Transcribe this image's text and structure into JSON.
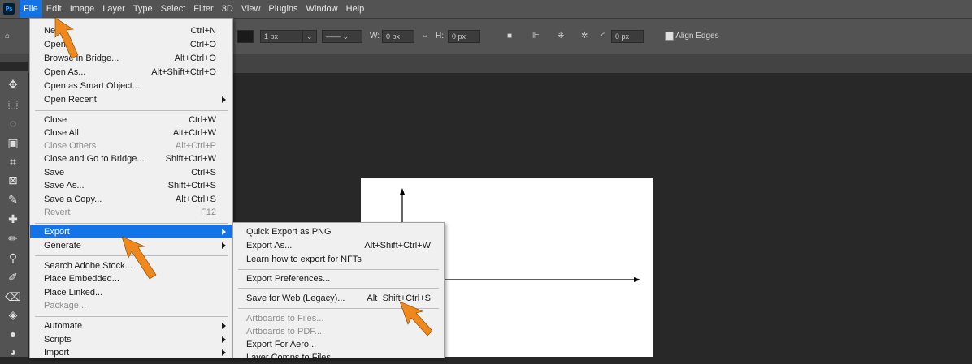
{
  "app": {
    "logo": "Ps"
  },
  "menubar": {
    "items": [
      "File",
      "Edit",
      "Image",
      "Layer",
      "Type",
      "Select",
      "Filter",
      "3D",
      "View",
      "Plugins",
      "Window",
      "Help"
    ],
    "active": "File"
  },
  "options": {
    "stroke_width": "1 px",
    "w_label": "W:",
    "w_value": "0 px",
    "h_label": "H:",
    "h_value": "0 px",
    "radius_value": "0 px",
    "align_edges": "Align Edges"
  },
  "file_menu": {
    "items": [
      {
        "label": "New...",
        "shortcut": "Ctrl+N"
      },
      {
        "label": "Open...",
        "shortcut": "Ctrl+O"
      },
      {
        "label": "Browse in Bridge...",
        "shortcut": "Alt+Ctrl+O"
      },
      {
        "label": "Open As...",
        "shortcut": "Alt+Shift+Ctrl+O"
      },
      {
        "label": "Open as Smart Object...",
        "shortcut": ""
      },
      {
        "label": "Open Recent",
        "shortcut": "",
        "submenu": true
      },
      {
        "label": "Close",
        "shortcut": "Ctrl+W"
      },
      {
        "label": "Close All",
        "shortcut": "Alt+Ctrl+W"
      },
      {
        "label": "Close Others",
        "shortcut": "Alt+Ctrl+P",
        "disabled": true
      },
      {
        "label": "Close and Go to Bridge...",
        "shortcut": "Shift+Ctrl+W"
      },
      {
        "label": "Save",
        "shortcut": "Ctrl+S"
      },
      {
        "label": "Save As...",
        "shortcut": "Shift+Ctrl+S"
      },
      {
        "label": "Save a Copy...",
        "shortcut": "Alt+Ctrl+S"
      },
      {
        "label": "Revert",
        "shortcut": "F12",
        "disabled": true
      },
      {
        "label": "Export",
        "shortcut": "",
        "submenu": true,
        "highlighted": true
      },
      {
        "label": "Generate",
        "shortcut": "",
        "submenu": true
      },
      {
        "label": "Search Adobe Stock...",
        "shortcut": ""
      },
      {
        "label": "Place Embedded...",
        "shortcut": ""
      },
      {
        "label": "Place Linked...",
        "shortcut": ""
      },
      {
        "label": "Package...",
        "shortcut": "",
        "disabled": true
      },
      {
        "label": "Automate",
        "shortcut": "",
        "submenu": true
      },
      {
        "label": "Scripts",
        "shortcut": "",
        "submenu": true
      },
      {
        "label": "Import",
        "shortcut": "",
        "submenu": true
      }
    ]
  },
  "export_menu": {
    "items": [
      {
        "label": "Quick Export as PNG",
        "shortcut": ""
      },
      {
        "label": "Export As...",
        "shortcut": "Alt+Shift+Ctrl+W"
      },
      {
        "label": "Learn how to export for NFTs",
        "shortcut": ""
      },
      {
        "label": "Export Preferences...",
        "shortcut": ""
      },
      {
        "label": "Save for Web (Legacy)...",
        "shortcut": "Alt+Shift+Ctrl+S"
      },
      {
        "label": "Artboards to Files...",
        "shortcut": "",
        "disabled": true
      },
      {
        "label": "Artboards to PDF...",
        "shortcut": "",
        "disabled": true
      },
      {
        "label": "Export For Aero...",
        "shortcut": ""
      },
      {
        "label": "Layer Comps to Files...",
        "shortcut": ""
      }
    ]
  },
  "colors": {
    "highlight": "#1473e6",
    "menu_bg": "#f0f0f0",
    "arrow": "#f0891d"
  }
}
